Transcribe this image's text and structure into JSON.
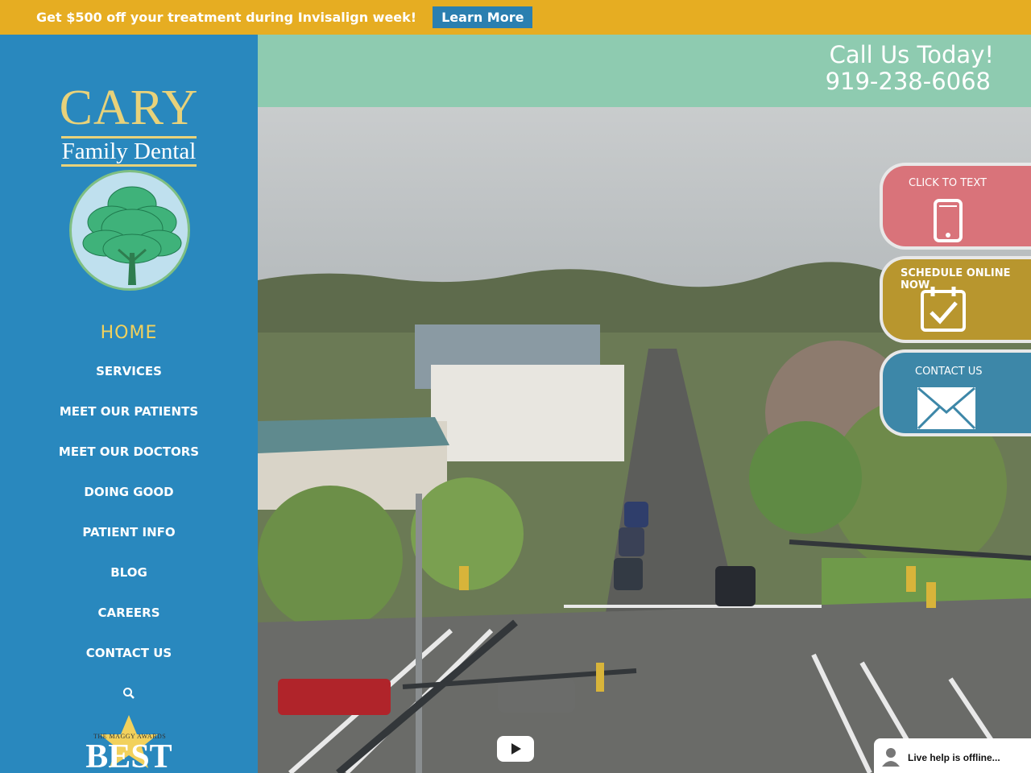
{
  "promo": {
    "text": "Get $500 off your treatment during Invisalign week!",
    "button_label": "Learn More"
  },
  "brand": {
    "name_line1": "CARY",
    "name_line2": "Family Dental"
  },
  "nav": {
    "items": [
      {
        "label": "HOME",
        "active": true
      },
      {
        "label": "SERVICES"
      },
      {
        "label": "MEET OUR PATIENTS"
      },
      {
        "label": "MEET OUR DOCTORS"
      },
      {
        "label": "DOING GOOD"
      },
      {
        "label": "PATIENT INFO"
      },
      {
        "label": "BLOG"
      },
      {
        "label": "CAREERS"
      },
      {
        "label": "CONTACT US"
      }
    ],
    "search_icon": "search-icon"
  },
  "award": {
    "top_text": "THE MAGGY AWARDS",
    "main_text": "BEST"
  },
  "header": {
    "call_title": "Call Us Today!",
    "phone": "919-238-6068"
  },
  "side_tabs": {
    "text": {
      "label": "CLICK TO TEXT",
      "icon": "phone-icon",
      "color": "#d9737a"
    },
    "schedule": {
      "label": "SCHEDULE ONLINE NOW",
      "icon": "calendar-check-icon",
      "color": "#b8962e"
    },
    "contact": {
      "label": "CONTACT US",
      "icon": "envelope-icon",
      "color": "#3d87a8"
    }
  },
  "live_help": {
    "text": "Live help is offline..."
  },
  "colors": {
    "promo_bg": "#e6ad22",
    "sidebar_bg": "#2988be",
    "header_bg": "#8ecbb0",
    "active_nav": "#f2d15c"
  }
}
